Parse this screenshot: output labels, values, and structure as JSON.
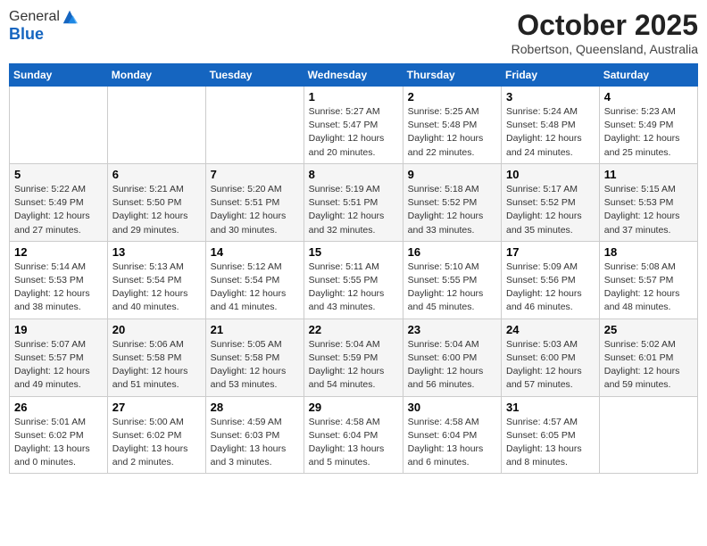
{
  "header": {
    "logo_line1": "General",
    "logo_line2": "Blue",
    "month_title": "October 2025",
    "location": "Robertson, Queensland, Australia"
  },
  "weekdays": [
    "Sunday",
    "Monday",
    "Tuesday",
    "Wednesday",
    "Thursday",
    "Friday",
    "Saturday"
  ],
  "weeks": [
    [
      {
        "day": "",
        "info": ""
      },
      {
        "day": "",
        "info": ""
      },
      {
        "day": "",
        "info": ""
      },
      {
        "day": "1",
        "info": "Sunrise: 5:27 AM\nSunset: 5:47 PM\nDaylight: 12 hours\nand 20 minutes."
      },
      {
        "day": "2",
        "info": "Sunrise: 5:25 AM\nSunset: 5:48 PM\nDaylight: 12 hours\nand 22 minutes."
      },
      {
        "day": "3",
        "info": "Sunrise: 5:24 AM\nSunset: 5:48 PM\nDaylight: 12 hours\nand 24 minutes."
      },
      {
        "day": "4",
        "info": "Sunrise: 5:23 AM\nSunset: 5:49 PM\nDaylight: 12 hours\nand 25 minutes."
      }
    ],
    [
      {
        "day": "5",
        "info": "Sunrise: 5:22 AM\nSunset: 5:49 PM\nDaylight: 12 hours\nand 27 minutes."
      },
      {
        "day": "6",
        "info": "Sunrise: 5:21 AM\nSunset: 5:50 PM\nDaylight: 12 hours\nand 29 minutes."
      },
      {
        "day": "7",
        "info": "Sunrise: 5:20 AM\nSunset: 5:51 PM\nDaylight: 12 hours\nand 30 minutes."
      },
      {
        "day": "8",
        "info": "Sunrise: 5:19 AM\nSunset: 5:51 PM\nDaylight: 12 hours\nand 32 minutes."
      },
      {
        "day": "9",
        "info": "Sunrise: 5:18 AM\nSunset: 5:52 PM\nDaylight: 12 hours\nand 33 minutes."
      },
      {
        "day": "10",
        "info": "Sunrise: 5:17 AM\nSunset: 5:52 PM\nDaylight: 12 hours\nand 35 minutes."
      },
      {
        "day": "11",
        "info": "Sunrise: 5:15 AM\nSunset: 5:53 PM\nDaylight: 12 hours\nand 37 minutes."
      }
    ],
    [
      {
        "day": "12",
        "info": "Sunrise: 5:14 AM\nSunset: 5:53 PM\nDaylight: 12 hours\nand 38 minutes."
      },
      {
        "day": "13",
        "info": "Sunrise: 5:13 AM\nSunset: 5:54 PM\nDaylight: 12 hours\nand 40 minutes."
      },
      {
        "day": "14",
        "info": "Sunrise: 5:12 AM\nSunset: 5:54 PM\nDaylight: 12 hours\nand 41 minutes."
      },
      {
        "day": "15",
        "info": "Sunrise: 5:11 AM\nSunset: 5:55 PM\nDaylight: 12 hours\nand 43 minutes."
      },
      {
        "day": "16",
        "info": "Sunrise: 5:10 AM\nSunset: 5:55 PM\nDaylight: 12 hours\nand 45 minutes."
      },
      {
        "day": "17",
        "info": "Sunrise: 5:09 AM\nSunset: 5:56 PM\nDaylight: 12 hours\nand 46 minutes."
      },
      {
        "day": "18",
        "info": "Sunrise: 5:08 AM\nSunset: 5:57 PM\nDaylight: 12 hours\nand 48 minutes."
      }
    ],
    [
      {
        "day": "19",
        "info": "Sunrise: 5:07 AM\nSunset: 5:57 PM\nDaylight: 12 hours\nand 49 minutes."
      },
      {
        "day": "20",
        "info": "Sunrise: 5:06 AM\nSunset: 5:58 PM\nDaylight: 12 hours\nand 51 minutes."
      },
      {
        "day": "21",
        "info": "Sunrise: 5:05 AM\nSunset: 5:58 PM\nDaylight: 12 hours\nand 53 minutes."
      },
      {
        "day": "22",
        "info": "Sunrise: 5:04 AM\nSunset: 5:59 PM\nDaylight: 12 hours\nand 54 minutes."
      },
      {
        "day": "23",
        "info": "Sunrise: 5:04 AM\nSunset: 6:00 PM\nDaylight: 12 hours\nand 56 minutes."
      },
      {
        "day": "24",
        "info": "Sunrise: 5:03 AM\nSunset: 6:00 PM\nDaylight: 12 hours\nand 57 minutes."
      },
      {
        "day": "25",
        "info": "Sunrise: 5:02 AM\nSunset: 6:01 PM\nDaylight: 12 hours\nand 59 minutes."
      }
    ],
    [
      {
        "day": "26",
        "info": "Sunrise: 5:01 AM\nSunset: 6:02 PM\nDaylight: 13 hours\nand 0 minutes."
      },
      {
        "day": "27",
        "info": "Sunrise: 5:00 AM\nSunset: 6:02 PM\nDaylight: 13 hours\nand 2 minutes."
      },
      {
        "day": "28",
        "info": "Sunrise: 4:59 AM\nSunset: 6:03 PM\nDaylight: 13 hours\nand 3 minutes."
      },
      {
        "day": "29",
        "info": "Sunrise: 4:58 AM\nSunset: 6:04 PM\nDaylight: 13 hours\nand 5 minutes."
      },
      {
        "day": "30",
        "info": "Sunrise: 4:58 AM\nSunset: 6:04 PM\nDaylight: 13 hours\nand 6 minutes."
      },
      {
        "day": "31",
        "info": "Sunrise: 4:57 AM\nSunset: 6:05 PM\nDaylight: 13 hours\nand 8 minutes."
      },
      {
        "day": "",
        "info": ""
      }
    ]
  ]
}
